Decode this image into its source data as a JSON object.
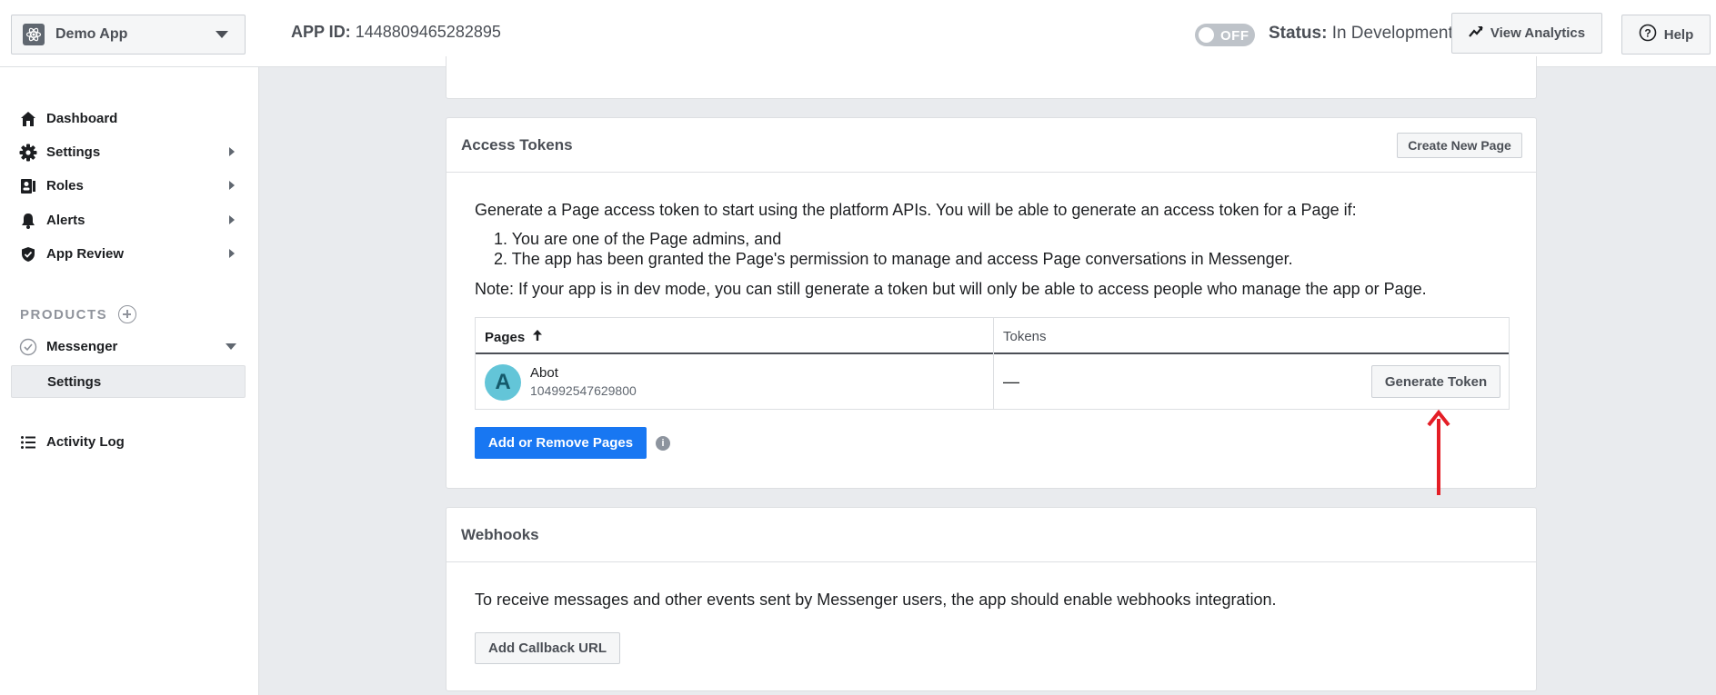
{
  "topbar": {
    "app_name": "Demo App",
    "app_id_label": "APP ID:",
    "app_id_value": "1448809465282895",
    "toggle_label": "OFF",
    "status_label": "Status:",
    "status_value": "In Development",
    "analytics_label": "View Analytics",
    "help_label": "Help"
  },
  "sidebar": {
    "items": [
      {
        "label": "Dashboard",
        "icon": "home-icon"
      },
      {
        "label": "Settings",
        "icon": "gear-icon"
      },
      {
        "label": "Roles",
        "icon": "roles-icon"
      },
      {
        "label": "Alerts",
        "icon": "bell-icon"
      },
      {
        "label": "App Review",
        "icon": "shield-icon"
      }
    ],
    "products_label": "PRODUCTS",
    "messenger_label": "Messenger",
    "messenger_settings_label": "Settings",
    "activity_log_label": "Activity Log"
  },
  "access_tokens": {
    "title": "Access Tokens",
    "create_page_label": "Create New Page",
    "intro": "Generate a Page access token to start using the platform APIs. You will be able to generate an access token for a Page if:",
    "conditions": [
      "1. You are one of the Page admins, and",
      "2. The app has been granted the Page's permission to manage and access Page conversations in Messenger."
    ],
    "note": "Note: If your app is in dev mode, you can still generate a token but will only be able to access people who manage the app or Page.",
    "table": {
      "col_pages": "Pages",
      "col_tokens": "Tokens",
      "rows": [
        {
          "avatar_letter": "A",
          "name": "Abot",
          "id": "104992547629800",
          "token": "—",
          "action": "Generate Token"
        }
      ]
    },
    "add_remove_label": "Add or Remove Pages"
  },
  "webhooks": {
    "title": "Webhooks",
    "text": "To receive messages and other events sent by Messenger users, the app should enable webhooks integration.",
    "callback_label": "Add Callback URL"
  },
  "colors": {
    "accent": "#1877f2",
    "annotation": "#e41e26",
    "avatar": "#63c5d8"
  }
}
